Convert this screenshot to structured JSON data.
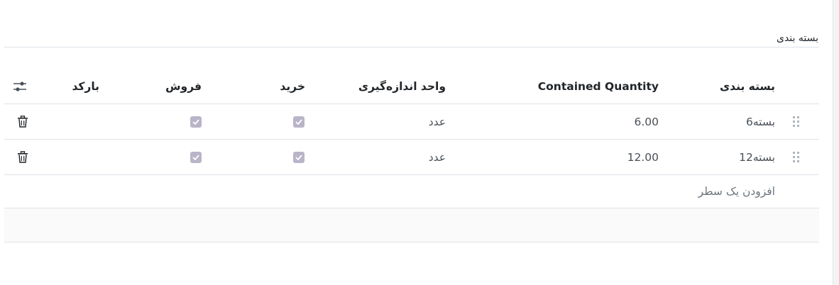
{
  "section": {
    "title": "بسته بندی"
  },
  "table": {
    "headers": {
      "packaging": "بسته بندی",
      "contained_quantity": "Contained Quantity",
      "uom": "واحد اندازه‌گیری",
      "purchase": "خرید",
      "sales": "فروش",
      "barcode": "بارکد"
    },
    "rows": [
      {
        "packaging": "6بسته",
        "contained_quantity": "6.00",
        "uom": "عدد",
        "purchase": true,
        "sales": true,
        "barcode": ""
      },
      {
        "packaging": "12بسته",
        "contained_quantity": "12.00",
        "uom": "عدد",
        "purchase": true,
        "sales": true,
        "barcode": ""
      }
    ],
    "add_line": "افزودن یک سطر"
  },
  "icons": {
    "optional_columns": "sliders-icon",
    "delete": "trash-icon",
    "drag": "drag-handle-icon",
    "checkbox": "checkmark-icon"
  },
  "colors": {
    "checkbox_fill": "#b9b4c7"
  }
}
